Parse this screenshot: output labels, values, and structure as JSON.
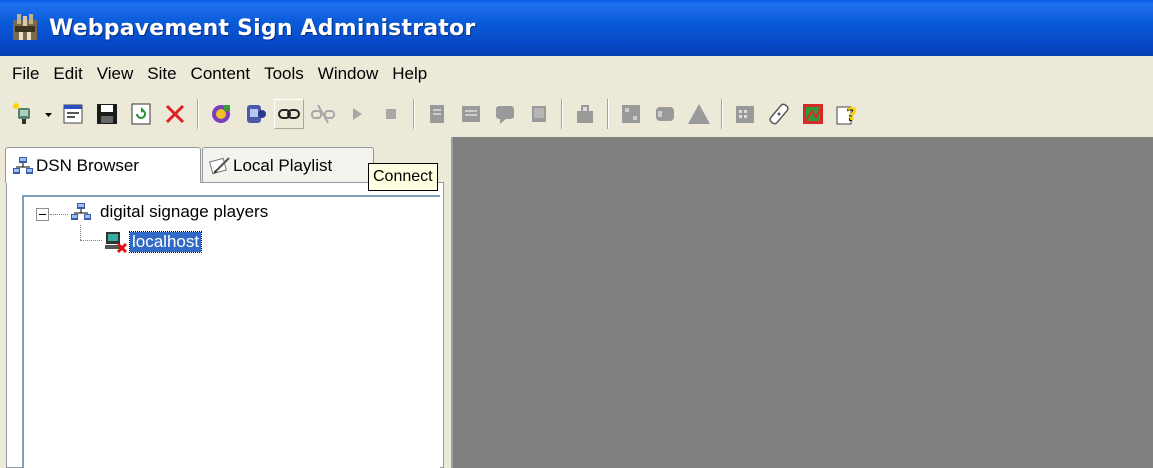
{
  "window": {
    "title": "Webpavement Sign Administrator"
  },
  "menu": [
    "File",
    "Edit",
    "View",
    "Site",
    "Content",
    "Tools",
    "Window",
    "Help"
  ],
  "toolbar": {
    "groups": [
      [
        "new-connection-icon",
        "dropdown-arrow",
        "properties-icon",
        "save-icon",
        "refresh-icon",
        "delete-icon"
      ],
      [
        "publish-icon",
        "preview-icon",
        "connect-icon",
        "disconnect-icon",
        "play-icon",
        "stop-icon"
      ],
      [
        "content-a-icon",
        "content-b-icon",
        "content-c-icon",
        "content-d-icon"
      ],
      [
        "upload-icon"
      ],
      [
        "region-icon",
        "screen-icon",
        "alert-icon"
      ],
      [
        "calendar-icon",
        "remote-icon",
        "map-icon",
        "help-icon"
      ]
    ],
    "tooltip": "Connect"
  },
  "tabs": [
    {
      "label": "DSN Browser",
      "icon": "network-icon",
      "active": true
    },
    {
      "label": "Local Playlist",
      "icon": "playlist-icon",
      "active": false
    }
  ],
  "tree": {
    "root": {
      "label": "digital signage players",
      "icon": "network-icon",
      "expanded": true
    },
    "children": [
      {
        "label": "localhost",
        "icon": "player-disconnected-icon",
        "selected": true
      }
    ]
  },
  "colors": {
    "titlebar": "#0a5bd8",
    "selection": "#316ac5",
    "mdi_background": "#808080",
    "tooltip_background": "#ffffe1"
  }
}
